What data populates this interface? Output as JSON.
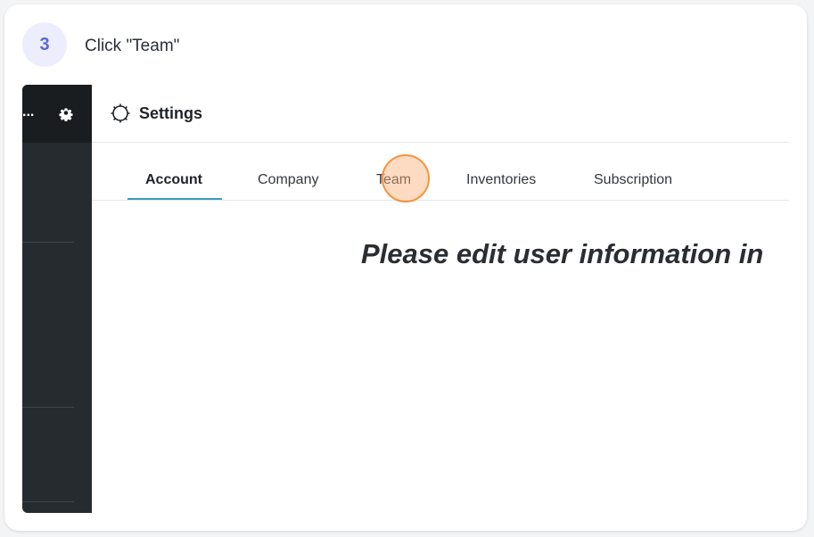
{
  "step": {
    "number": "3",
    "instruction": "Click \"Team\""
  },
  "sidebar": {
    "top_text": "...",
    "top_icon": "gear-icon"
  },
  "header": {
    "icon": "settings-gear-outline-icon",
    "title": "Settings"
  },
  "tabs": [
    {
      "label": "Account",
      "active": true
    },
    {
      "label": "Company",
      "active": false
    },
    {
      "label": "Team",
      "active": false
    },
    {
      "label": "Inventories",
      "active": false
    },
    {
      "label": "Subscription",
      "active": false
    }
  ],
  "content": {
    "message": "Please edit user information in"
  },
  "colors": {
    "accent": "#3a9bbf",
    "click_marker": "#f7923f",
    "step_badge": "#5b67d8",
    "sidebar": "#262b2f"
  }
}
